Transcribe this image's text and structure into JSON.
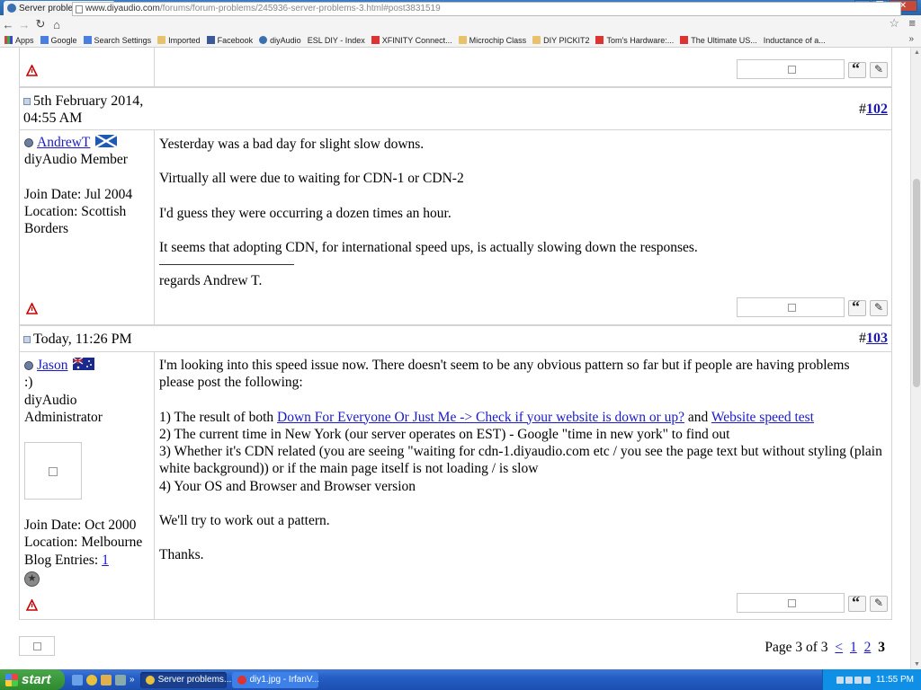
{
  "browser": {
    "tab_title": "Server problems? - Fi",
    "tab_close": "×",
    "url_host": "www.diyaudio.com",
    "url_path": "/forums/forum-problems/245936-server-problems-3.html#post3831519",
    "bookmarks": [
      {
        "label": "Apps",
        "icon": "apps"
      },
      {
        "label": "Google",
        "icon": "g"
      },
      {
        "label": "Search Settings",
        "icon": "g"
      },
      {
        "label": "Imported",
        "icon": "folder"
      },
      {
        "label": "Facebook",
        "icon": "fb"
      },
      {
        "label": "diyAudio",
        "icon": "diy"
      },
      {
        "label": "ESL DIY - Index",
        "icon": "page"
      },
      {
        "label": "XFINITY Connect...",
        "icon": "red"
      },
      {
        "label": "Microchip Class",
        "icon": "folder"
      },
      {
        "label": "DIY PICKIT2",
        "icon": "folder"
      },
      {
        "label": "Tom's Hardware:...",
        "icon": "red"
      },
      {
        "label": "The Ultimate US...",
        "icon": "red"
      },
      {
        "label": "Inductance of a...",
        "icon": "page"
      }
    ],
    "bookmarks_more": "»"
  },
  "posts": [
    {
      "date": "5th February 2014, 04:55 AM",
      "number_prefix": "#",
      "number": "102",
      "user": {
        "name": "AndrewT",
        "title": "diyAudio Member",
        "join_date": "Join Date: Jul 2004",
        "location": "Location: Scottish Borders",
        "flag": "scotland"
      },
      "message": [
        "Yesterday was a bad day for slight slow downs.",
        "Virtually all were due to waiting for CDN-1 or CDN-2",
        "I'd guess they were occurring a dozen times an hour.",
        "It seems that adopting CDN, for international speed ups, is actually slowing down the responses."
      ],
      "signature": "regards Andrew T."
    },
    {
      "date": "Today, 11:26 PM",
      "number_prefix": "#",
      "number": "103",
      "user": {
        "name": "Jason",
        "custom_title": ":)",
        "title": "diyAudio Administrator",
        "join_date": "Join Date: Oct 2000",
        "location": "Location: Melbourne",
        "blog_label": "Blog Entries: ",
        "blog_count": "1",
        "flag": "australia"
      },
      "message_intro": "I'm looking into this speed issue now. There doesn't seem to be any obvious pattern so far but if people are having problems please post the following:",
      "item1_prefix": "1) The result of both ",
      "item1_link1": "Down For Everyone Or Just Me -> Check if your website is down or up?",
      "item1_and": " and ",
      "item1_link2": "Website speed test",
      "item2": "2) The current time in New York (our server operates on EST) - Google \"time in new york\" to find out",
      "item3": "3) Whether it's CDN related (you are seeing \"waiting for cdn-1.diyaudio.com etc / you see the page text but without styling (plain white background)) or if the main page itself is not loading / is slow",
      "item4": "4) Your OS and Browser and Browser version",
      "closing1": "We'll try to work out a pattern.",
      "closing2": "Thanks."
    }
  ],
  "pagination": {
    "label": "Page 3 of 3",
    "prev": "<",
    "pages": [
      "1",
      "2"
    ],
    "current": "3"
  },
  "taskbar": {
    "start_label": "start",
    "more": "»",
    "items": [
      {
        "label": "Server problems...",
        "active": true
      },
      {
        "label": "diy1.jpg - IrfanV...",
        "active": false
      }
    ],
    "clock": "11:55 PM"
  },
  "colors": {
    "link": "#1a1acc",
    "border": "#d4d4d4",
    "taskbar": "#245ec4",
    "start": "#2e8a2e"
  }
}
